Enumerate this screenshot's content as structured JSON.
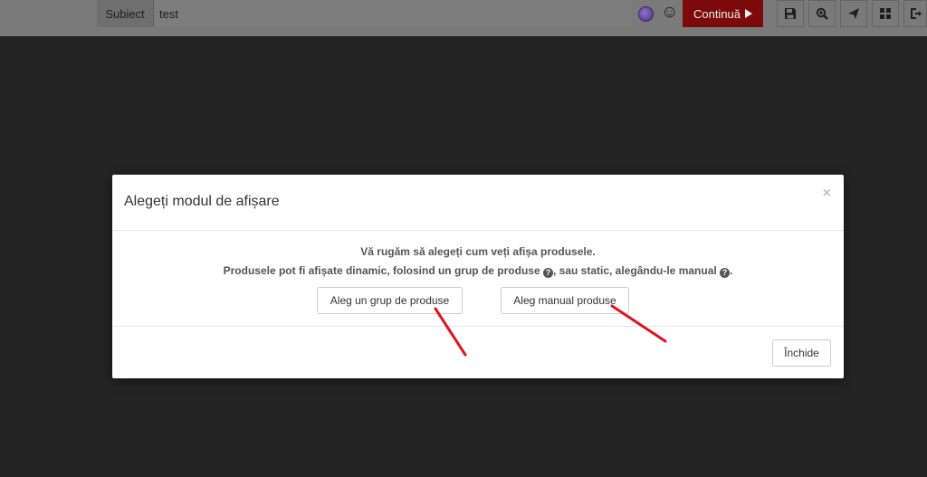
{
  "toolbar": {
    "subject_label": "Subiect",
    "subject_value": "test",
    "continue_label": "Continuă",
    "tools": [
      "floppy-disk-icon",
      "zoom-in-icon",
      "send-icon",
      "grid-icon",
      "export-icon"
    ]
  },
  "modal": {
    "title": "Alegeți modul de afișare",
    "close_symbol": "×",
    "message_line1": "Vă rugăm să alegeți cum veți afișa produsele.",
    "message_line2_part1": "Produsele pot fi afișate dinamic, folosind un grup de produse ",
    "message_line2_part2": ", sau static, alegându-le manual ",
    "message_line2_part3": ".",
    "help_glyph": "?",
    "choice_group_label": "Aleg un grup de produse",
    "choice_manual_label": "Aleg manual produse",
    "close_button_label": "Închide"
  },
  "colors": {
    "backdrop": "#242424",
    "continue_bg": "#7d0a0a",
    "annotation": "#e0141c"
  }
}
